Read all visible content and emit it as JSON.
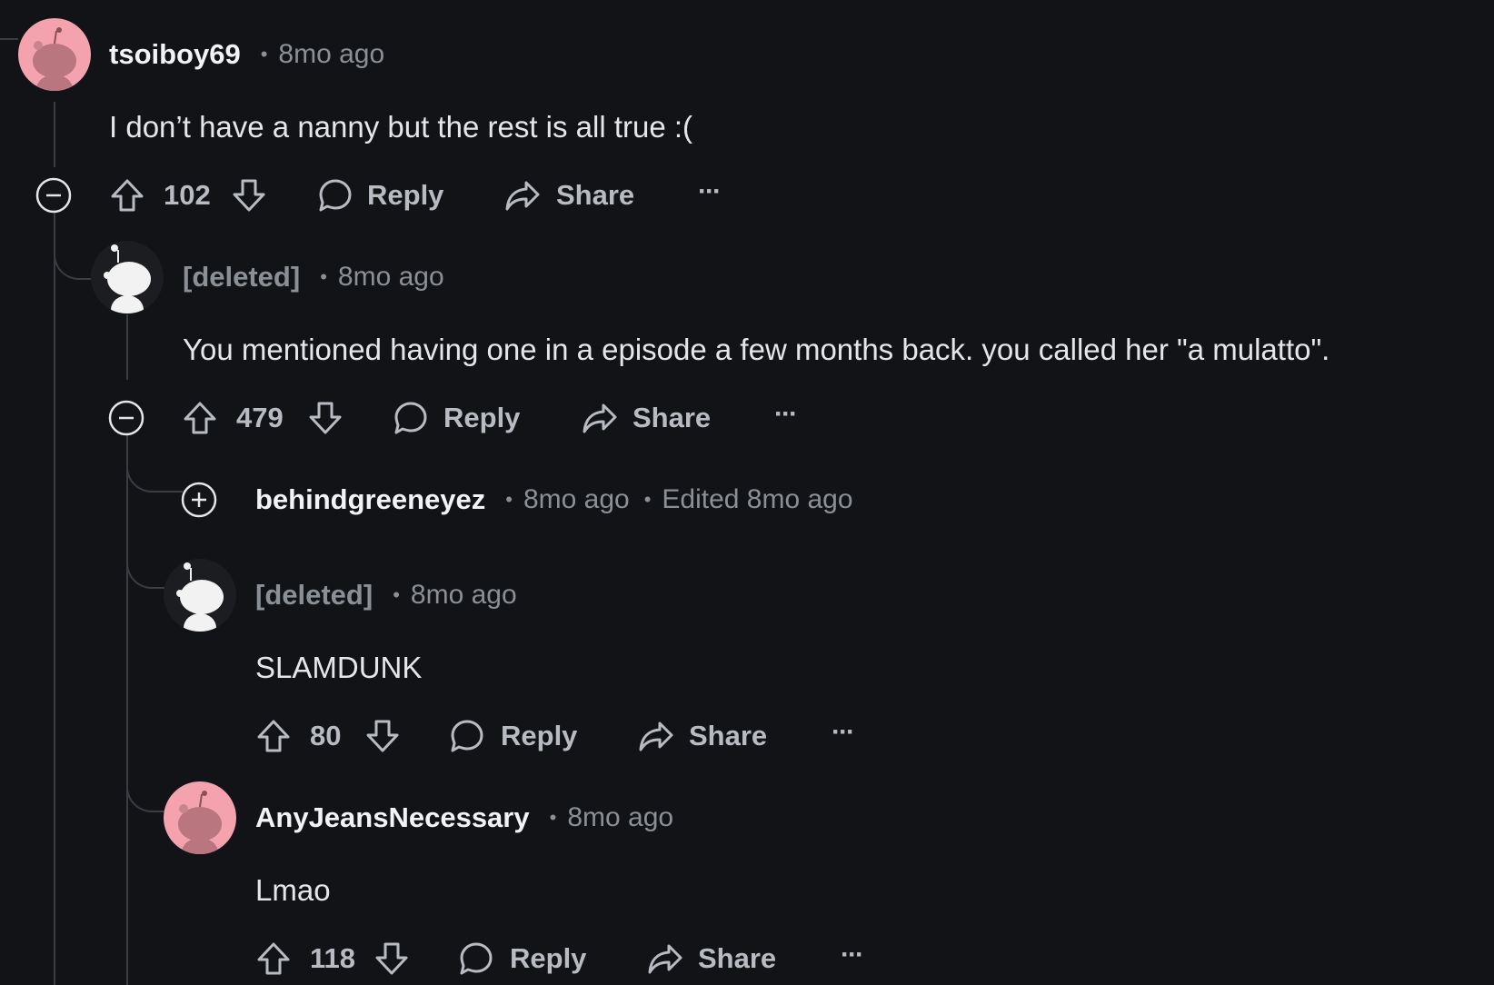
{
  "comments": [
    {
      "author": "tsoiboy69",
      "sep": "•",
      "time": "8mo ago",
      "body": "I don’t have a nanny but the rest is all true :(",
      "score": "102",
      "reply": "Reply",
      "share": "Share",
      "more": "···",
      "avatar": "pink-snoo-icon",
      "collapse": "minus"
    },
    {
      "author": "[deleted]",
      "sep": "•",
      "time": "8mo ago",
      "body": "You mentioned having one in a episode a few months back. you called her \"a mulatto\".",
      "score": "479",
      "reply": "Reply",
      "share": "Share",
      "more": "···",
      "avatar": "dark-snoo-icon",
      "collapse": "minus"
    },
    {
      "author": "behindgreeneyez",
      "sep": "•",
      "time": "8mo ago",
      "sep2": "•",
      "edited": "Edited 8mo ago",
      "collapse": "plus"
    },
    {
      "author": "[deleted]",
      "sep": "•",
      "time": "8mo ago",
      "body": "SLAMDUNK",
      "score": "80",
      "reply": "Reply",
      "share": "Share",
      "more": "···",
      "avatar": "dark-snoo-icon"
    },
    {
      "author": "AnyJeansNecessary",
      "sep": "•",
      "time": "8mo ago",
      "body": "Lmao",
      "score": "118",
      "reply": "Reply",
      "share": "Share",
      "more": "···",
      "avatar": "pink-snoo-icon"
    }
  ],
  "colors": {
    "background": "#121316",
    "thread_line": "#3a3d42",
    "pink_avatar": "#f4a3ae",
    "text_muted": "#8b8f96",
    "text_primary": "#f2f3f5"
  }
}
